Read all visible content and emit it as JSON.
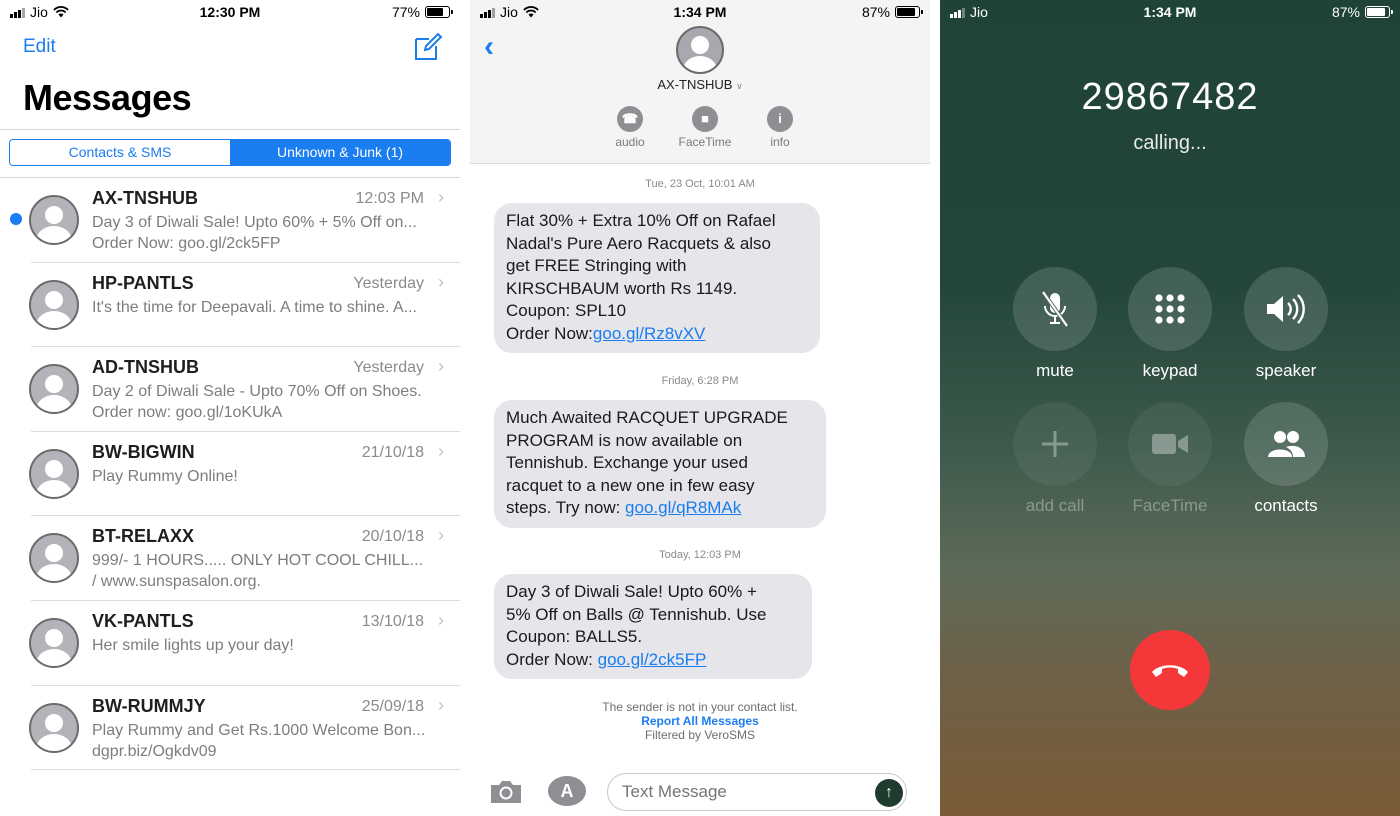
{
  "panel1": {
    "status": {
      "carrier": "Jio",
      "time": "12:30 PM",
      "battery": "77%",
      "battery_level": 0.77
    },
    "edit_label": "Edit",
    "title": "Messages",
    "segments": {
      "left": "Contacts & SMS",
      "right": "Unknown & Junk (1)",
      "selected": "right"
    },
    "threads": [
      {
        "name": "AX-TNSHUB",
        "date": "12:03 PM",
        "unread": true,
        "preview": [
          "Day 3 of Diwali Sale! Upto 60% + 5% Off on...",
          "Order Now: goo.gl/2ck5FP"
        ]
      },
      {
        "name": "HP-PANTLS",
        "date": "Yesterday",
        "unread": false,
        "preview": [
          "It's the time for Deepavali. A time to shine. A..."
        ]
      },
      {
        "name": "AD-TNSHUB",
        "date": "Yesterday",
        "unread": false,
        "preview": [
          "Day 2 of Diwali Sale - Upto 70% Off on Shoes.",
          "Order now: goo.gl/1oKUkA"
        ]
      },
      {
        "name": "BW-BIGWIN",
        "date": "21/10/18",
        "unread": false,
        "preview": [
          "Play Rummy Online!"
        ]
      },
      {
        "name": "BT-RELAXX",
        "date": "20/10/18",
        "unread": false,
        "preview": [
          "999/-  1 HOURS..... ONLY HOT COOL CHILL...",
          "/ www.sunspasalon.org."
        ]
      },
      {
        "name": "VK-PANTLS",
        "date": "13/10/18",
        "unread": false,
        "preview": [
          "Her smile lights up your day!"
        ]
      },
      {
        "name": "BW-RUMMJY",
        "date": "25/09/18",
        "unread": false,
        "preview": [
          "Play Rummy and Get Rs.1000 Welcome Bon...",
          "dgpr.biz/Ogkdv09"
        ]
      }
    ]
  },
  "panel2": {
    "status": {
      "carrier": "Jio",
      "time": "1:34 PM",
      "battery": "87%",
      "battery_level": 0.87
    },
    "contact": "AX-TNSHUB",
    "actions": {
      "audio": "audio",
      "facetime": "FaceTime",
      "info": "info"
    },
    "messages": [
      {
        "stamp": "Tue, 23 Oct, 10:01 AM",
        "lines": [
          "Flat 30% + Extra 10% Off on Rafael",
          "Nadal's Pure Aero Racquets & also",
          "get FREE Stringing with",
          "KIRSCHBAUM worth Rs 1149.",
          "Coupon: SPL10"
        ],
        "link_prefix": "Order Now:",
        "link": "goo.gl/Rz8vXV"
      },
      {
        "stamp": "Friday, 6:28 PM",
        "lines": [
          "Much Awaited RACQUET UPGRADE",
          "PROGRAM is now available on",
          "Tennishub. Exchange your used",
          "racquet to a new one in few easy"
        ],
        "link_prefix": "steps. Try now: ",
        "link": "goo.gl/qR8MAk"
      },
      {
        "stamp": "Today, 12:03 PM",
        "lines": [
          "Day 3 of Diwali Sale! Upto 60% +",
          "5% Off on Balls @ Tennishub. Use",
          "Coupon: BALLS5."
        ],
        "link_prefix": "Order Now: ",
        "link": "goo.gl/2ck5FP"
      }
    ],
    "notice": {
      "line1": "The sender is not in your contact list.",
      "report": "Report All Messages",
      "line3": "Filtered by VeroSMS"
    },
    "input_placeholder": "Text Message"
  },
  "panel3": {
    "status": {
      "carrier": "Jio",
      "time": "1:34 PM",
      "battery": "87%",
      "battery_level": 0.87
    },
    "number": "29867482",
    "state": "calling...",
    "buttons": {
      "mute": "mute",
      "keypad": "keypad",
      "speaker": "speaker",
      "add_call": "add call",
      "facetime": "FaceTime",
      "contacts": "contacts"
    }
  }
}
